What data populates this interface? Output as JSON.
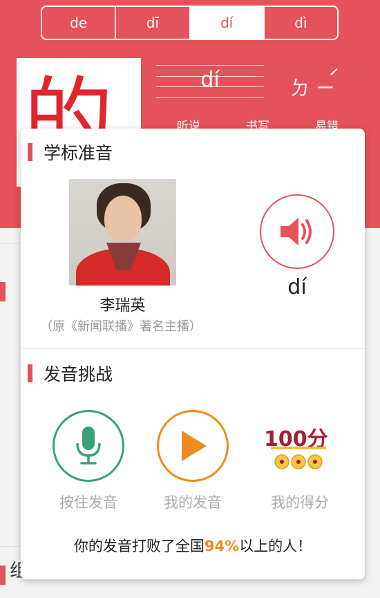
{
  "tabs": [
    {
      "label": "de",
      "active": false
    },
    {
      "label": "dī",
      "active": false
    },
    {
      "label": "dí",
      "active": true
    },
    {
      "label": "dì",
      "active": false
    }
  ],
  "character": "的",
  "pinyin": "dí",
  "zhuyin": "ㄉ ㄧ́",
  "sub_links": [
    "听说",
    "书写",
    "易错"
  ],
  "background_hint_text": "组词",
  "popup": {
    "section1_title": "学标准音",
    "speaker_name": "李瑞英",
    "speaker_desc": "（原《新闻联播》著名主播）",
    "speaker_pinyin": "dí",
    "section2_title": "发音挑战",
    "buttons": [
      {
        "label": "按住发音",
        "icon": "microphone-icon"
      },
      {
        "label": "我的发音",
        "icon": "play-icon"
      },
      {
        "label": "我的得分",
        "icon": "medals-icon"
      }
    ],
    "score_text": "100分",
    "result_prefix": "你的发音打败了全国",
    "result_percent": "94%",
    "result_suffix": "以上的人！"
  },
  "colors": {
    "header_red": "#e65259",
    "mic_green": "#3aa07a",
    "play_orange": "#f08a1d",
    "score_maroon": "#a61c3a"
  }
}
